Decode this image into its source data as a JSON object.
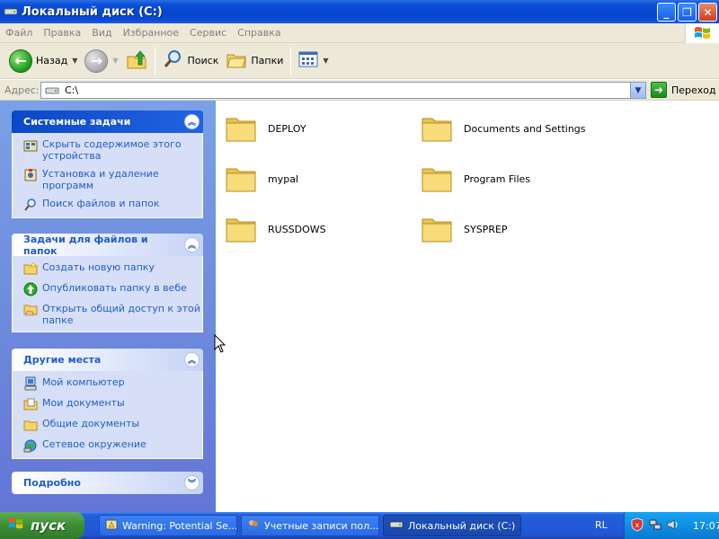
{
  "window": {
    "title": "Локальный диск (C:)",
    "min_glyph": "_",
    "max_glyph": "❐",
    "close_glyph": "✕"
  },
  "menu": [
    "Файл",
    "Правка",
    "Вид",
    "Избранное",
    "Сервис",
    "Справка"
  ],
  "toolbar": {
    "back_label": "Назад",
    "search_label": "Поиск",
    "folders_label": "Папки"
  },
  "address": {
    "label": "Адрес:",
    "value": "C:\\",
    "go_label": "Переход"
  },
  "taskpane": {
    "system": {
      "title": "Системные задачи",
      "items": [
        {
          "label": "Скрыть содержимое этого устройства",
          "icon": "hide-contents-icon"
        },
        {
          "label": "Установка и удаление программ",
          "icon": "add-remove-programs-icon"
        },
        {
          "label": "Поиск файлов и папок",
          "icon": "search-icon"
        }
      ]
    },
    "file_tasks": {
      "title": "Задачи для файлов и папок",
      "items": [
        {
          "label": "Создать новую папку",
          "icon": "new-folder-icon"
        },
        {
          "label": "Опубликовать папку в вебе",
          "icon": "publish-web-icon"
        },
        {
          "label": "Открыть общий доступ к этой папке",
          "icon": "share-folder-icon"
        }
      ]
    },
    "other_places": {
      "title": "Другие места",
      "items": [
        {
          "label": "Мой компьютер",
          "icon": "my-computer-icon"
        },
        {
          "label": "Мои документы",
          "icon": "my-documents-icon"
        },
        {
          "label": "Общие документы",
          "icon": "shared-documents-icon"
        },
        {
          "label": "Сетевое окружение",
          "icon": "network-places-icon"
        }
      ]
    },
    "details": {
      "title": "Подробно"
    }
  },
  "folders": [
    "DEPLOY",
    "Documents and Settings",
    "mypal",
    "Program Files",
    "RUSSDOWS",
    "SYSPREP"
  ],
  "taskbar": {
    "start_label": "пуск",
    "tasks": [
      {
        "label": "Warning: Potential Se...",
        "icon": "warning-window-icon"
      },
      {
        "label": "Учетные записи пол...",
        "icon": "user-accounts-icon"
      },
      {
        "label": "Локальный диск (C:)",
        "icon": "drive-icon"
      }
    ],
    "language": "RL",
    "clock": "17:07"
  },
  "colors": {
    "titlebar": "#0a4fd6",
    "taskpane_bg": "#6f8ee0",
    "task_link": "#215dc6",
    "folder_yellow": "#f5d56b"
  }
}
